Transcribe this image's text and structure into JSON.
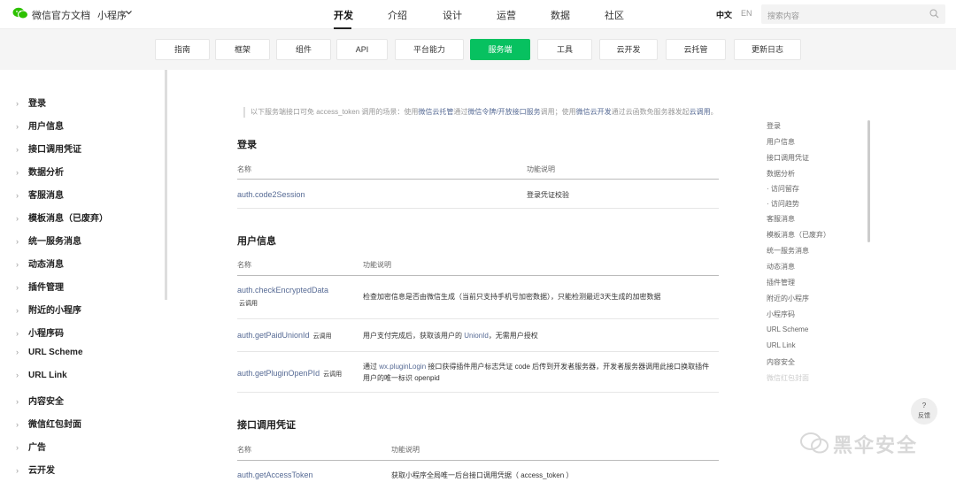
{
  "header": {
    "brand": "微信官方文档",
    "dot": "·",
    "product": "小程序",
    "nav": [
      "开发",
      "介绍",
      "设计",
      "运营",
      "数据",
      "社区"
    ],
    "lang_zh": "中文",
    "lang_en": "EN",
    "search_placeholder": "搜索内容"
  },
  "subnav": {
    "tabs": [
      "指南",
      "框架",
      "组件",
      "API",
      "平台能力",
      "服务端",
      "工具",
      "云开发",
      "云托管",
      "更新日志"
    ],
    "active": "服务端"
  },
  "sidebar": {
    "items": [
      "登录",
      "用户信息",
      "接口调用凭证",
      "数据分析",
      "客服消息",
      "模板消息（已废弃）",
      "统一服务消息",
      "动态消息",
      "插件管理",
      "附近的小程序",
      "小程序码",
      "URL Scheme",
      "URL Link",
      "内容安全",
      "微信红包封面",
      "广告",
      "云开发"
    ]
  },
  "main": {
    "notice": {
      "prefix": "以下服务端接口可免 access_token 调用的场景：使用",
      "link1": "微信云托管",
      "mid1": "通过",
      "link2": "微信令牌/开放接口服务",
      "mid2": "调用；使用",
      "link3": "微信云开发",
      "mid3": "通过云函数免服务器发起",
      "link4": "云调用",
      "suffix": "。"
    },
    "sections": [
      {
        "title": "登录",
        "col_name": "名称",
        "col_desc": "功能说明",
        "rows": [
          {
            "api": "auth.code2Session",
            "tag": "",
            "desc": "登录凭证校验"
          }
        ]
      },
      {
        "title": "用户信息",
        "col_name": "名称",
        "col_desc": "功能说明",
        "rows": [
          {
            "api": "auth.checkEncryptedData",
            "tag": "云调用",
            "desc": "检查加密信息是否由微信生成（当前只支持手机号加密数据），只能检测最近3天生成的加密数据"
          },
          {
            "api": "auth.getPaidUnionId",
            "tag": "云调用",
            "desc_pre": "用户支付完成后，获取该用户的 ",
            "desc_link": "UnionId",
            "desc_post": "，无需用户授权"
          },
          {
            "api": "auth.getPluginOpenPId",
            "tag": "云调用",
            "desc_pre": "通过 ",
            "desc_link": "wx.pluginLogin",
            "desc_post": " 接口获得插件用户标志凭证 code 后传到开发者服务器，开发者服务器调用此接口换取插件",
            "desc_line2": "用户的唯一标识 openpid"
          }
        ]
      },
      {
        "title": "接口调用凭证",
        "col_name": "名称",
        "col_desc": "功能说明",
        "rows": [
          {
            "api": "auth.getAccessToken",
            "tag": "",
            "desc": "获取小程序全局唯一后台接口调用凭据（ access_token ）"
          }
        ]
      }
    ]
  },
  "toc": {
    "items": [
      "登录",
      "用户信息",
      "接口调用凭证",
      "数据分析",
      "· 访问留存",
      "· 访问趋势",
      "客服消息",
      "模板消息（已废弃）",
      "统一服务消息",
      "动态消息",
      "插件管理",
      "附近的小程序",
      "小程序码",
      "URL Scheme",
      "URL Link",
      "内容安全",
      "微信红包封面"
    ]
  },
  "feedback": {
    "icon": "?",
    "label": "反馈"
  },
  "watermark": {
    "text": "黑伞安全"
  },
  "colors": {
    "accent": "#07c160",
    "link": "#576b95"
  }
}
